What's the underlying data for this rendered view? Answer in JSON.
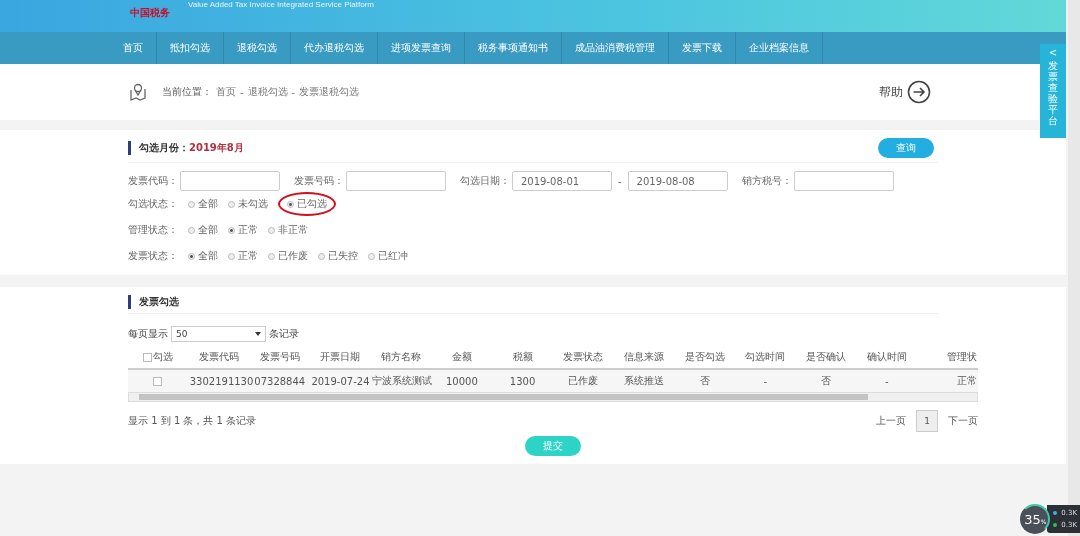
{
  "header": {
    "logo": "中国税务",
    "subtitle": "Value Added Tax Invoice Integrated Service Platform"
  },
  "nav": [
    {
      "label": "首页",
      "selected": false
    },
    {
      "label": "抵扣勾选",
      "selected": false
    },
    {
      "label": "退税勾选",
      "selected": false
    },
    {
      "label": "代办退税勾选",
      "selected": false
    },
    {
      "label": "进项发票查询",
      "selected": false
    },
    {
      "label": "税务事项通知书",
      "selected": false
    },
    {
      "label": "成品油消费税管理",
      "selected": false
    },
    {
      "label": "发票下载",
      "selected": false
    },
    {
      "label": "企业档案信息",
      "selected": false
    }
  ],
  "breadcrumb": {
    "label": "当前位置：",
    "items": [
      "首页",
      "退税勾选",
      "发票退税勾选"
    ],
    "separator": "-"
  },
  "help": "帮助",
  "side_tab": {
    "arrow": "<",
    "label": "发票查验平台"
  },
  "filter": {
    "title": "勾选月份：",
    "month": "2019年8月",
    "query_button": "查询",
    "fields": [
      {
        "label": "发票代码："
      },
      {
        "label": "发票号码："
      },
      {
        "label": "勾选日期：",
        "value": "2019-08-01",
        "separator": "-",
        "value2": "2019-08-08"
      },
      {
        "label": "销方税号："
      }
    ],
    "radio_groups": [
      {
        "label": "勾选状态：",
        "options": [
          {
            "label": "全部",
            "selected": false,
            "highlighted": false
          },
          {
            "label": "未勾选",
            "selected": false,
            "highlighted": false
          },
          {
            "label": "已勾选",
            "selected": true,
            "highlighted": true
          }
        ]
      },
      {
        "label": "管理状态：",
        "options": [
          {
            "label": "全部",
            "selected": false,
            "highlighted": false
          },
          {
            "label": "正常",
            "selected": true,
            "highlighted": false
          },
          {
            "label": "非正常",
            "selected": false,
            "highlighted": false
          }
        ]
      },
      {
        "label": "发票状态：",
        "options": [
          {
            "label": "全部",
            "selected": true,
            "highlighted": false
          },
          {
            "label": "正常",
            "selected": false,
            "highlighted": false
          },
          {
            "label": "已作废",
            "selected": false,
            "highlighted": false
          },
          {
            "label": "已失控",
            "selected": false,
            "highlighted": false
          },
          {
            "label": "已红冲",
            "selected": false,
            "highlighted": false
          }
        ]
      }
    ]
  },
  "table_section": {
    "title": "发票勾选",
    "page_size_label": "每页显示",
    "page_size": "50",
    "page_size_suffix": "条记录",
    "select_all_checked": false,
    "columns": [
      "勾选",
      "发票代码",
      "发票号码",
      "开票日期",
      "销方名称",
      "金额",
      "税额",
      "发票状态",
      "信息来源",
      "是否勾选",
      "勾选时间",
      "是否确认",
      "确认时间",
      "管理状"
    ],
    "rows": [
      {
        "checked": false,
        "cells": [
          null,
          "3302191130",
          "07328844",
          "2019-07-24",
          "宁波系统测试",
          "10000",
          "1300",
          "已作废",
          "系统推送",
          "否",
          "-",
          "否",
          "-",
          "正常"
        ]
      }
    ],
    "summary": "显示 1 到 1 条，共 1 条记录",
    "prev": "上一页",
    "pages": [
      {
        "label": "1",
        "selected": true
      }
    ],
    "next": "下一页",
    "submit": "提交"
  },
  "overlay": {
    "percent": "35",
    "percent_sign": "%",
    "upload": "0.3K",
    "download": "0.3K"
  }
}
